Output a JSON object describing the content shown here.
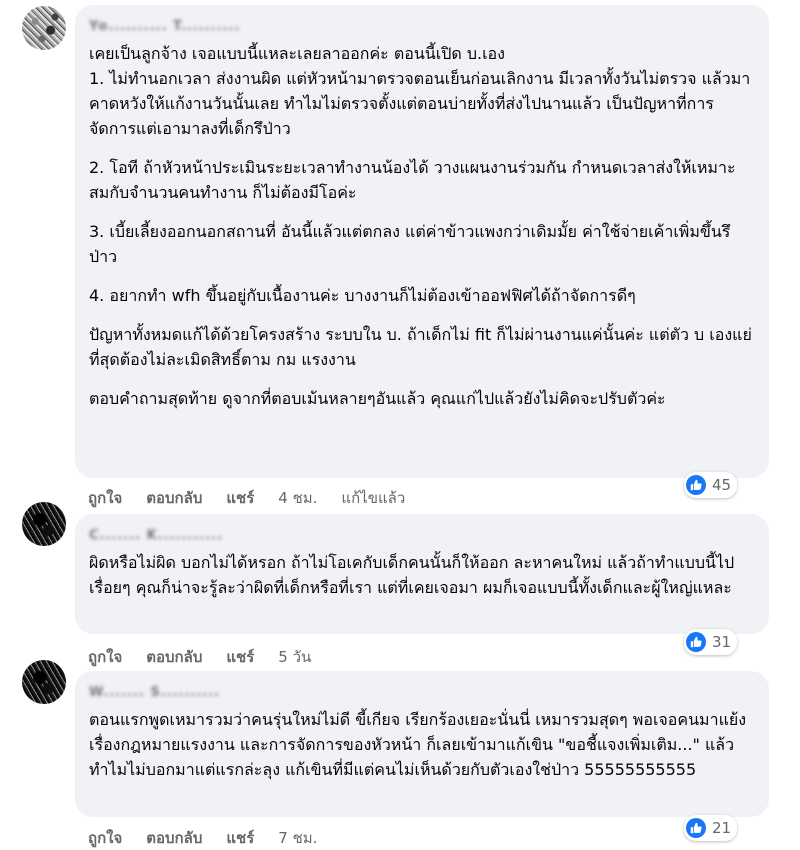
{
  "comments": [
    {
      "author": "Yo..........  T..........",
      "paragraphs": [
        "เคยเป็นลูกจ้าง เจอแบบนี้แหละเลยลาออกค่ะ ตอนนี้เปิด บ.เอง",
        "1. ไม่ทำนอกเวลา ส่งงานผิด แต่หัวหน้ามาตรวจตอนเย็นก่อนเลิกงาน มีเวลาทั้งวันไม่ตรวจ แล้วมาคาดหวังให้แก้งานวันนั้นเลย ทำไมไม่ตรวจตั้งแต่ตอนบ่ายทั้งที่ส่งไปนานแล้ว เป็นปัญหาที่การจัดการแต่เอามาลงที่เด็กรึป่าว",
        "2. โอที ถ้าหัวหน้าประเมินระยะเวลาทำงานน้องได้ วางแผนงานร่วมกัน กำหนดเวลาส่งให้เหมาะสมกับจำนวนคนทำงาน ก็ไม่ต้องมีโอค่ะ",
        "3. เบี้ยเลี้ยงออกนอกสถานที่ อันนี้แล้วแต่ตกลง แต่ค่าข้าวแพงกว่าเดิมมั้ย ค่าใช้จ่ายเค้าเพิ่มขึ้นรึป่าว",
        "4. อยากทำ wfh ขึ้นอยู่กับเนื้องานค่ะ บางงานก็ไม่ต้องเข้าออฟฟิศได้ถ้าจัดการดีๆ",
        "ปัญหาทั้งหมดแก้ได้ด้วยโครงสร้าง ระบบใน บ. ถ้าเด็กไม่ fit ก็ไม่ผ่านงานแค่นั้นค่ะ แต่ตัว บ เองแย่ที่สุดต้องไม่ละเมิดสิทธิ์ตาม กม แรงงาน",
        "ตอบคำถามสุดท้าย ดูจากที่ตอบเม้นหลายๆอันแล้ว คุณแก่ไปแล้วยังไม่คิดจะปรับตัวค่ะ"
      ],
      "reactions": "45",
      "like": "ถูกใจ",
      "reply": "ตอบกลับ",
      "share": "แชร์",
      "time": "4 ชม.",
      "edited": "แก้ไขแล้ว"
    },
    {
      "author": "C.......  K...........",
      "paragraphs": [
        "ผิดหรือไม่ผิด บอกไม่ได้หรอก ถ้าไม่โอเคกับเด็กคนนั้นก็ให้ออก ละหาคนใหม่ แล้วถ้าทำแบบนี้ไปเรื่อยๆ คุณก็น่าจะรู้ละว่าผิดที่เด็กหรือที่เรา แต่ที่เคยเจอมา ผมก็เจอแบบนี้ทั้งเด็กและผู้ใหญ่แหละ"
      ],
      "reactions": "31",
      "like": "ถูกใจ",
      "reply": "ตอบกลับ",
      "share": "แชร์",
      "time": "5 วัน"
    },
    {
      "author": "W.......  S..........",
      "paragraphs": [
        "ตอนแรกพูดเหมารวมว่าคนรุ่นใหม่ไม่ดี ขี้เกียจ เรียกร้องเยอะนั่นนี่ เหมารวมสุดๆ พอเจอคนมาแย้งเรื่องกฎหมายแรงงาน และการจัดการของหัวหน้า ก็เลยเข้ามาแก้เขิน \"ขอชี้แจงเพิ่มเติม...\" แล้วทำไมไม่บอกมาแต่แรกล่ะลุง แก้เขินที่มีแต่คนไม่เห็นด้วยกับตัวเองใช่ป่าว 55555555555"
      ],
      "reactions": "21",
      "like": "ถูกใจ",
      "reply": "ตอบกลับ",
      "share": "แชร์",
      "time": "7 ชม."
    }
  ],
  "colors": {
    "bubble": "#f0f2f5",
    "like_blue": "#1877f2",
    "meta_text": "#65676b"
  }
}
